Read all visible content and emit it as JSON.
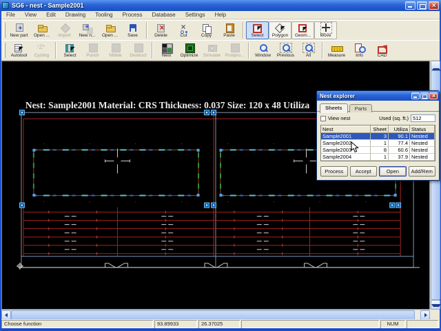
{
  "window": {
    "title": "SG6 - nest - Sample2001"
  },
  "menu": {
    "items": [
      "File",
      "View",
      "Edit",
      "Drawing",
      "Tooling",
      "Process",
      "Database",
      "Settings",
      "Help"
    ]
  },
  "toolbar_row1": [
    {
      "label": "New part"
    },
    {
      "label": "Open ..."
    },
    {
      "label": "Import",
      "disabled": true
    },
    {
      "label": "New n..."
    },
    {
      "label": "Open ..."
    },
    {
      "label": "Save"
    },
    {
      "label": "Delete"
    },
    {
      "label": "Cut"
    },
    {
      "label": "Copy"
    },
    {
      "label": "Paste"
    },
    {
      "label": "Select",
      "pressed": true
    },
    {
      "label": "Polygon"
    },
    {
      "label": "Geom..."
    },
    {
      "label": "Move"
    }
  ],
  "toolbar_row2": [
    {
      "label": "Autotool"
    },
    {
      "label": "Cycling",
      "disabled": true
    },
    {
      "label": "Select"
    },
    {
      "label": "Punch",
      "disabled": true
    },
    {
      "label": "Nibble",
      "disabled": true
    },
    {
      "label": "Destruct",
      "disabled": true
    },
    {
      "label": "Nest"
    },
    {
      "label": "Optimize"
    },
    {
      "label": "Simulate",
      "disabled": true
    },
    {
      "label": "Postpro...",
      "disabled": true
    },
    {
      "label": "Window"
    },
    {
      "label": "Previous"
    },
    {
      "label": "All"
    },
    {
      "label": "Measure"
    },
    {
      "label": "Info"
    },
    {
      "label": "CAD"
    }
  ],
  "canvas": {
    "header": "Nest: Sample2001  Material: CRS  Thickness: 0.037  Size: 120 x 48  Utiliza"
  },
  "nest_explorer": {
    "title": "Nest explorer",
    "tabs": [
      {
        "label": "Sheets",
        "active": true
      },
      {
        "label": "Parts",
        "active": false
      }
    ],
    "view_nest_label": "View nest",
    "used_label": "Used (sq. ft.)",
    "used_value": "512",
    "table": {
      "headers": [
        "Nest",
        "Sheet",
        "Utiliza",
        "Status"
      ],
      "rows": [
        {
          "nest": "Sample2001",
          "sheet": "3",
          "utiliza": "90.1",
          "status": "Nested",
          "selected": true
        },
        {
          "nest": "Sample2002",
          "sheet": "1",
          "utiliza": "77.4",
          "status": "Nested",
          "selected": false
        },
        {
          "nest": "Sample2003",
          "sheet": "8",
          "utiliza": "60.6",
          "status": "Nested",
          "selected": false
        },
        {
          "nest": "Sample2004",
          "sheet": "1",
          "utiliza": "37.9",
          "status": "Nested",
          "selected": false
        }
      ]
    },
    "buttons": [
      "Process",
      "Accept",
      "Open",
      "Add/Rem"
    ]
  },
  "statusbar": {
    "message": "Choose function",
    "coord_x": "93.89933",
    "coord_y": "26.37025",
    "num_lock": "NUM"
  },
  "colors": {
    "titlebar_blue": "#2a62d8",
    "face": "#ece9d8",
    "selection_blue": "#2f58b8",
    "sheet_red": "#a32222",
    "part_edge_orange": "#8a4a28",
    "punch_mark_cyan": "#4ec6d6",
    "lead_green": "#2f9440",
    "handle_blue": "#0b5cb0"
  }
}
